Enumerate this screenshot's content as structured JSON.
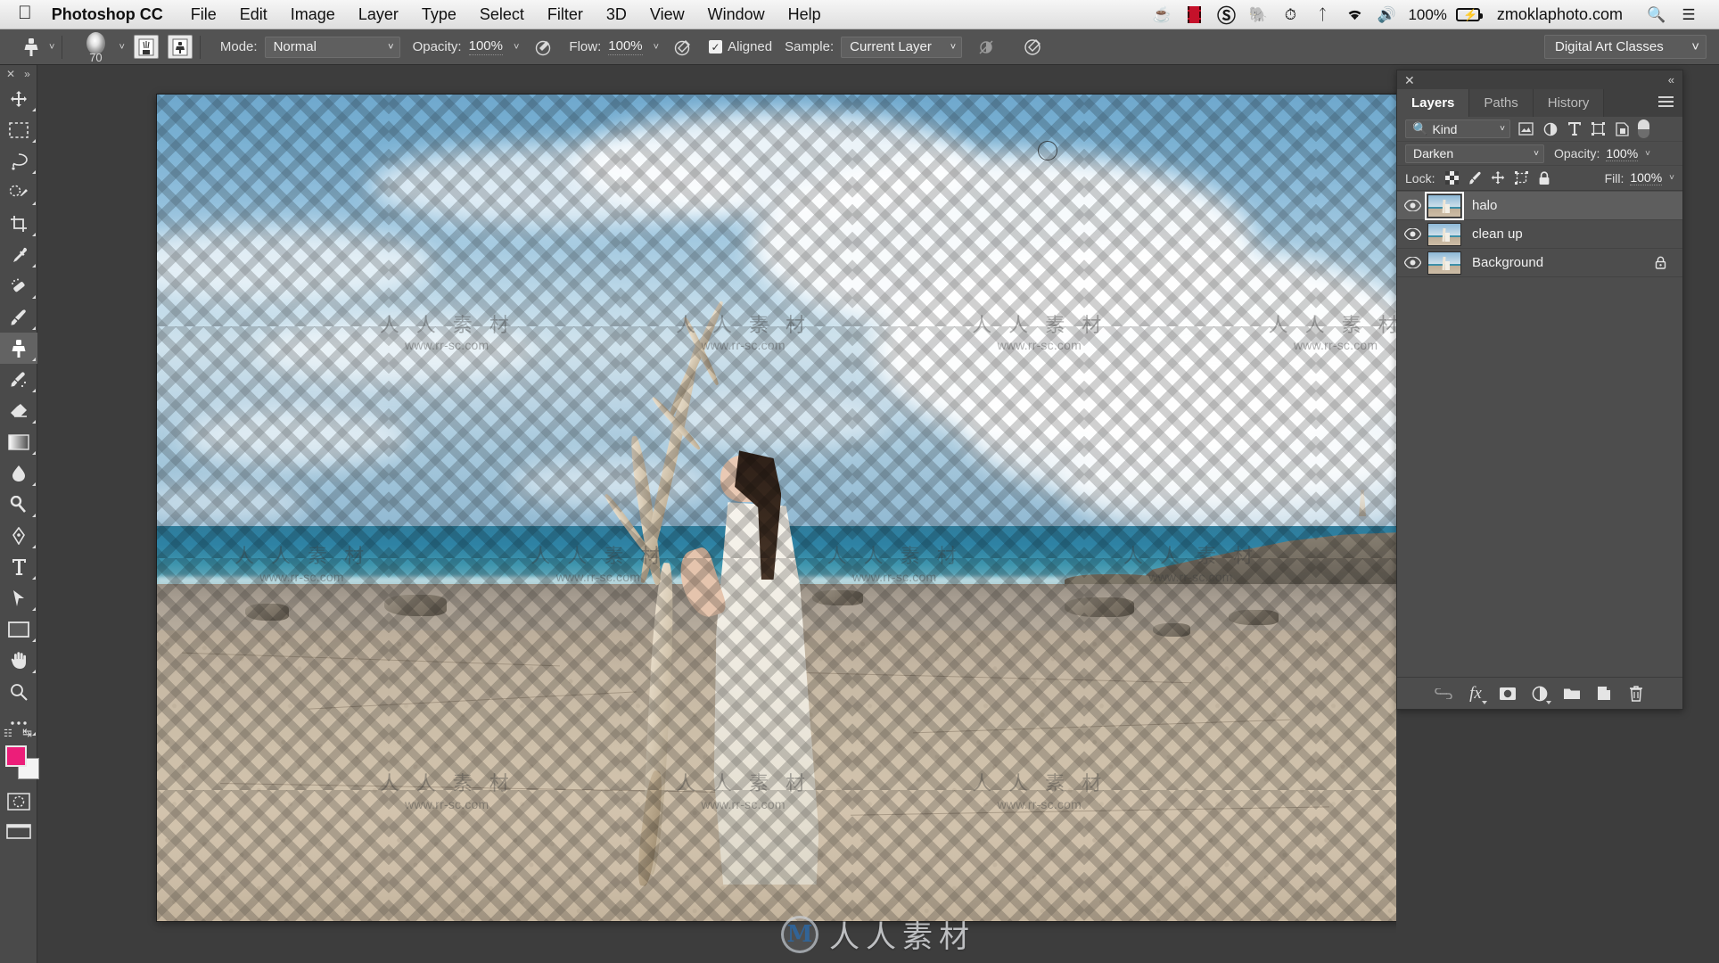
{
  "menubar": {
    "apple_icon": "apple-logo",
    "app_name": "Photoshop CC",
    "items": [
      "File",
      "Edit",
      "Image",
      "Layer",
      "Type",
      "Select",
      "Filter",
      "3D",
      "View",
      "Window",
      "Help"
    ],
    "status": {
      "coffee_icon": "coffee-cup-icon",
      "film_icon": "film-strip-icon",
      "creative_cloud_icon": "adobe-creative-cloud-icon",
      "evernote_icon": "evernote-elephant-icon",
      "timemachine_icon": "time-machine-icon",
      "bluetooth_icon": "bluetooth-icon",
      "wifi_icon": "wifi-icon",
      "volume_icon": "volume-icon",
      "battery_percent": "100%",
      "battery_icon": "battery-charging-icon",
      "user_account": "zmoklaphoto.com",
      "search_icon": "spotlight-search-icon",
      "notification_icon": "notification-center-icon"
    }
  },
  "optionsbar": {
    "tool_icon": "clone-stamp-tool-icon",
    "brush_size": "70",
    "brush_preset_icon": "brush-preset-picker-icon",
    "clone_source_icon": "clone-source-panel-icon",
    "mode_label": "Mode:",
    "mode_value": "Normal",
    "opacity_label": "Opacity:",
    "opacity_value": "100%",
    "opacity_pressure_icon": "pressure-opacity-icon",
    "flow_label": "Flow:",
    "flow_value": "100%",
    "airbrush_icon": "airbrush-icon",
    "aligned_label": "Aligned",
    "aligned_checked": true,
    "sample_label": "Sample:",
    "sample_value": "Current Layer",
    "ignore_adjustment_icon": "ignore-adjustment-layers-icon",
    "pressure_size_icon": "pressure-size-icon",
    "workspace": "Digital Art Classes"
  },
  "toolbar": {
    "collapse_icon": "close-icon",
    "expand_icon": "expand-panel-icon",
    "tools": [
      {
        "name": "move-tool",
        "label": "Move Tool"
      },
      {
        "name": "rectangular-marquee-tool",
        "label": "Rectangular Marquee Tool"
      },
      {
        "name": "lasso-tool",
        "label": "Lasso Tool"
      },
      {
        "name": "quick-selection-tool",
        "label": "Quick Selection Tool"
      },
      {
        "name": "crop-tool",
        "label": "Crop Tool"
      },
      {
        "name": "eyedropper-tool",
        "label": "Eyedropper Tool"
      },
      {
        "name": "spot-healing-brush-tool",
        "label": "Spot Healing Brush Tool"
      },
      {
        "name": "brush-tool",
        "label": "Brush Tool"
      },
      {
        "name": "clone-stamp-tool",
        "label": "Clone Stamp Tool",
        "active": true
      },
      {
        "name": "history-brush-tool",
        "label": "History Brush Tool"
      },
      {
        "name": "eraser-tool",
        "label": "Eraser Tool"
      },
      {
        "name": "gradient-tool",
        "label": "Gradient Tool"
      },
      {
        "name": "blur-tool",
        "label": "Blur Tool"
      },
      {
        "name": "dodge-tool",
        "label": "Dodge Tool"
      },
      {
        "name": "pen-tool",
        "label": "Pen Tool"
      },
      {
        "name": "horizontal-type-tool",
        "label": "Horizontal Type Tool"
      },
      {
        "name": "path-selection-tool",
        "label": "Path Selection Tool"
      },
      {
        "name": "rectangle-tool",
        "label": "Rectangle Tool"
      },
      {
        "name": "hand-tool",
        "label": "Hand Tool"
      },
      {
        "name": "zoom-tool",
        "label": "Zoom Tool"
      },
      {
        "name": "edit-toolbar-more",
        "label": "Edit Toolbar"
      }
    ],
    "foreground_color": "#ec1e79",
    "background_color": "#f4f4f4",
    "quick_mask_icon": "quick-mask-mode-icon",
    "screen_mode_icon": "screen-mode-icon"
  },
  "panel": {
    "close_icon": "close-icon",
    "collapse_icon": "collapse-to-icons-icon",
    "menu_icon": "panel-menu-icon",
    "tabs": [
      {
        "label": "Layers",
        "active": true
      },
      {
        "label": "Paths",
        "active": false
      },
      {
        "label": "History",
        "active": false
      }
    ],
    "filter": {
      "kind_label": "Kind",
      "search_icon": "search-icon",
      "icons": [
        "filter-pixel-layers-icon",
        "filter-adjustment-layers-icon",
        "filter-type-layers-icon",
        "filter-shape-layers-icon",
        "filter-smart-objects-icon"
      ],
      "toggle": "filter-enable-toggle"
    },
    "blend_mode": "Darken",
    "opacity_label": "Opacity:",
    "opacity_value": "100%",
    "lock_label": "Lock:",
    "lock_icons": [
      "lock-transparent-pixels-icon",
      "lock-image-pixels-icon",
      "lock-position-icon",
      "lock-artboard-nesting-icon",
      "lock-all-icon"
    ],
    "fill_label": "Fill:",
    "fill_value": "100%",
    "layers": [
      {
        "name": "halo",
        "visible": true,
        "selected": true,
        "locked": false
      },
      {
        "name": "clean up",
        "visible": true,
        "selected": false,
        "locked": false
      },
      {
        "name": "Background",
        "visible": true,
        "selected": false,
        "locked": true
      }
    ],
    "footer_buttons": [
      {
        "name": "link-layers-button",
        "icon": "link-icon"
      },
      {
        "name": "layer-style-button",
        "icon": "fx-icon"
      },
      {
        "name": "add-layer-mask-button",
        "icon": "layer-mask-icon"
      },
      {
        "name": "new-adjustment-layer-button",
        "icon": "half-circle-icon"
      },
      {
        "name": "new-group-button",
        "icon": "folder-icon"
      },
      {
        "name": "new-layer-button",
        "icon": "new-layer-icon"
      },
      {
        "name": "delete-layer-button",
        "icon": "trash-icon"
      }
    ]
  },
  "canvas": {
    "watermark_cn": "人 人 素 材",
    "watermark_url": "www.rr-sc.com",
    "center_watermark_text": "人人素材",
    "center_watermark_logo": "M",
    "brush_cursor": "brush-circle-cursor"
  }
}
